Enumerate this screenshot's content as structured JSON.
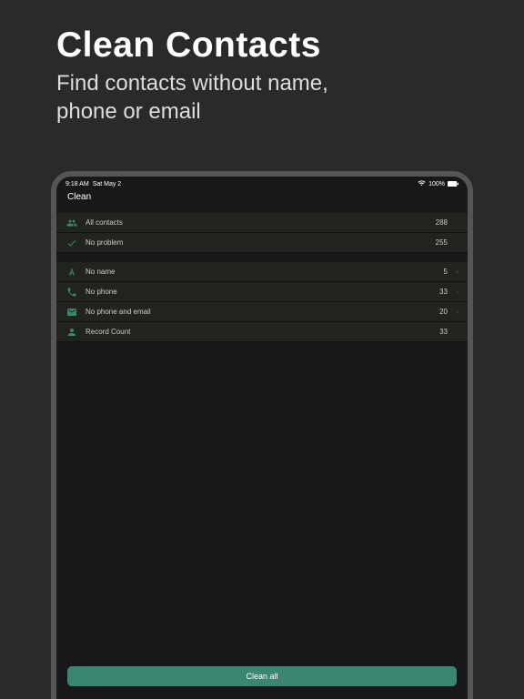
{
  "promo": {
    "title": "Clean Contacts",
    "subtitle_line1": "Find contacts without name,",
    "subtitle_line2": "phone or email"
  },
  "status_bar": {
    "time": "9:18 AM",
    "date": "Sat May 2",
    "battery_pct": "100%"
  },
  "nav": {
    "title": "Clean"
  },
  "section1": [
    {
      "icon": "people-icon",
      "label": "All contacts",
      "count": "288",
      "has_chevron": false
    },
    {
      "icon": "check-icon",
      "label": "No problem",
      "count": "255",
      "has_chevron": false
    }
  ],
  "section2": [
    {
      "icon": "letter-icon",
      "label": "No name",
      "count": "5",
      "has_chevron": true
    },
    {
      "icon": "phone-icon",
      "label": "No phone",
      "count": "33",
      "has_chevron": true
    },
    {
      "icon": "mail-icon",
      "label": "No phone and email",
      "count": "20",
      "has_chevron": true
    },
    {
      "icon": "person-count-icon",
      "label": "Record Count",
      "count": "33",
      "has_chevron": false
    }
  ],
  "button": {
    "clean_all": "Clean all"
  },
  "colors": {
    "accent": "#3d8573",
    "icon_teal": "#3d8573"
  }
}
